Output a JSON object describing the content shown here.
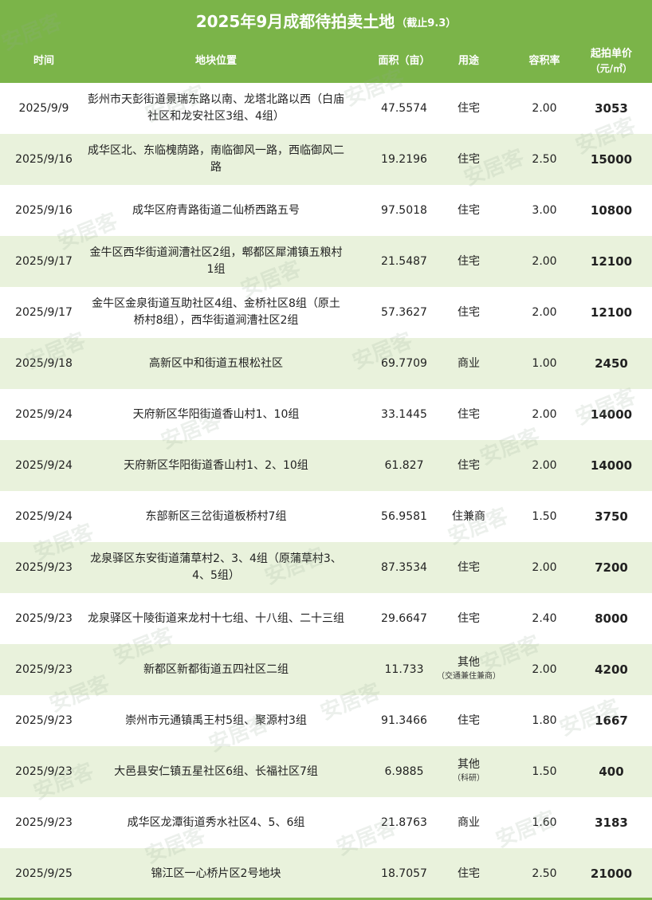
{
  "title": {
    "main": "2025年9月成都待拍卖土地",
    "sub": "（截止9.3）"
  },
  "header": {
    "date": "时间",
    "location": "地块位置",
    "area": "面积（亩）",
    "use": "用途",
    "far": "容积率",
    "price_line1": "起拍单价",
    "price_line2": "（元/㎡）"
  },
  "watermark": "安居客",
  "colors": {
    "accent": "#7bb449",
    "alt_row": "#e9f2dc"
  },
  "rows": [
    {
      "date": "2025/9/9",
      "location": "彭州市天彭街道景瑞东路以南、龙塔北路以西（白庙社区和龙安社区3组、4组）",
      "area": "47.5574",
      "use": "住宅",
      "use_note": "",
      "far": "2.00",
      "price": "3053"
    },
    {
      "date": "2025/9/16",
      "location": "成华区北、东临槐荫路，南临御风一路，西临御风二路",
      "area": "19.2196",
      "use": "住宅",
      "use_note": "",
      "far": "2.50",
      "price": "15000"
    },
    {
      "date": "2025/9/16",
      "location": "成华区府青路街道二仙桥西路五号",
      "area": "97.5018",
      "use": "住宅",
      "use_note": "",
      "far": "3.00",
      "price": "10800"
    },
    {
      "date": "2025/9/17",
      "location": "金牛区西华街道涧漕社区2组，郫都区犀浦镇五粮村1组",
      "area": "21.5487",
      "use": "住宅",
      "use_note": "",
      "far": "2.00",
      "price": "12100"
    },
    {
      "date": "2025/9/17",
      "location": "金牛区金泉街道互助社区4组、金桥社区8组（原土桥村8组），西华街道涧漕社区2组",
      "area": "57.3627",
      "use": "住宅",
      "use_note": "",
      "far": "2.00",
      "price": "12100"
    },
    {
      "date": "2025/9/18",
      "location": "高新区中和街道五根松社区",
      "area": "69.7709",
      "use": "商业",
      "use_note": "",
      "far": "1.00",
      "price": "2450"
    },
    {
      "date": "2025/9/24",
      "location": "天府新区华阳街道香山村1、10组",
      "area": "33.1445",
      "use": "住宅",
      "use_note": "",
      "far": "2.00",
      "price": "14000"
    },
    {
      "date": "2025/9/24",
      "location": "天府新区华阳街道香山村1、2、10组",
      "area": "61.827",
      "use": "住宅",
      "use_note": "",
      "far": "2.00",
      "price": "14000"
    },
    {
      "date": "2025/9/24",
      "location": "东部新区三岔街道板桥村7组",
      "area": "56.9581",
      "use": "住兼商",
      "use_note": "",
      "far": "1.50",
      "price": "3750"
    },
    {
      "date": "2025/9/23",
      "location": "龙泉驿区东安街道蒲草村2、3、4组（原蒲草村3、4、5组）",
      "area": "87.3534",
      "use": "住宅",
      "use_note": "",
      "far": "2.00",
      "price": "7200"
    },
    {
      "date": "2025/9/23",
      "location": "龙泉驿区十陵街道来龙村十七组、十八组、二十三组",
      "area": "29.6647",
      "use": "住宅",
      "use_note": "",
      "far": "2.40",
      "price": "8000"
    },
    {
      "date": "2025/9/23",
      "location": "新都区新都街道五四社区二组",
      "area": "11.733",
      "use": "其他",
      "use_note": "（交通兼住兼商）",
      "far": "2.00",
      "price": "4200"
    },
    {
      "date": "2025/9/23",
      "location": "崇州市元通镇禹王村5组、聚源村3组",
      "area": "91.3466",
      "use": "住宅",
      "use_note": "",
      "far": "1.80",
      "price": "1667"
    },
    {
      "date": "2025/9/23",
      "location": "大邑县安仁镇五星社区6组、长福社区7组",
      "area": "6.9885",
      "use": "其他",
      "use_note": "（科研）",
      "far": "1.50",
      "price": "400"
    },
    {
      "date": "2025/9/23",
      "location": "成华区龙潭街道秀水社区4、5、6组",
      "area": "21.8763",
      "use": "商业",
      "use_note": "",
      "far": "1.60",
      "price": "3183"
    },
    {
      "date": "2025/9/25",
      "location": "锦江区一心桥片区2号地块",
      "area": "18.7057",
      "use": "住宅",
      "use_note": "",
      "far": "2.50",
      "price": "21000"
    }
  ]
}
